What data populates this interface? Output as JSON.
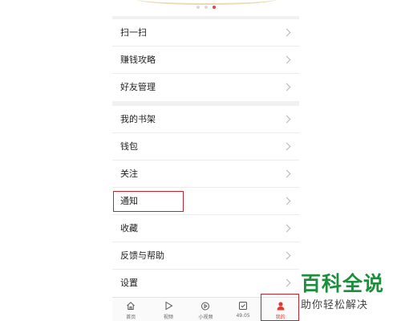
{
  "banner": {
    "page_dots": 3,
    "active_dot": 3
  },
  "groups": [
    {
      "items": [
        {
          "label": "扫一扫"
        },
        {
          "label": "赚钱攻略"
        },
        {
          "label": "好友管理"
        }
      ]
    },
    {
      "items": [
        {
          "label": "我的书架"
        },
        {
          "label": "钱包"
        },
        {
          "label": "关注"
        },
        {
          "label": "通知",
          "highlighted": true
        },
        {
          "label": "收藏"
        },
        {
          "label": "反馈与帮助"
        },
        {
          "label": "设置"
        }
      ]
    }
  ],
  "tabbar": {
    "active_tab": "我的",
    "tabs": [
      {
        "label": "首页",
        "icon": "home-icon"
      },
      {
        "label": "视频",
        "icon": "play-icon"
      },
      {
        "label": "小视频",
        "icon": "short-video-icon"
      },
      {
        "label": "49.05",
        "icon": "task-check-icon"
      },
      {
        "label": "我的",
        "icon": "user-icon"
      }
    ]
  },
  "colors": {
    "accent": "#e33a2f",
    "highlight_box": "#c5242a",
    "watermark": "#1d8e3b"
  },
  "watermark": {
    "title": "百科全说",
    "subtitle": "助你轻松解决"
  }
}
